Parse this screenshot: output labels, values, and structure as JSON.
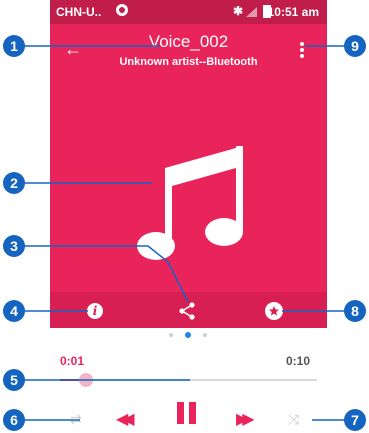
{
  "status_bar": {
    "carrier": "CHN-U..",
    "time": "10:51 am"
  },
  "header": {
    "title": "Voice_002",
    "subtitle": "Unknown artist--Bluetooth"
  },
  "info_button": {
    "glyph": "i"
  },
  "progress": {
    "elapsed": "0:01",
    "total": "0:10",
    "fraction": 0.1
  },
  "callouts": [
    "1",
    "2",
    "3",
    "4",
    "5",
    "6",
    "7",
    "8",
    "9"
  ],
  "colors": {
    "accent": "#e8245b",
    "callout": "#1565c0",
    "status_bar": "#c01d4b"
  }
}
